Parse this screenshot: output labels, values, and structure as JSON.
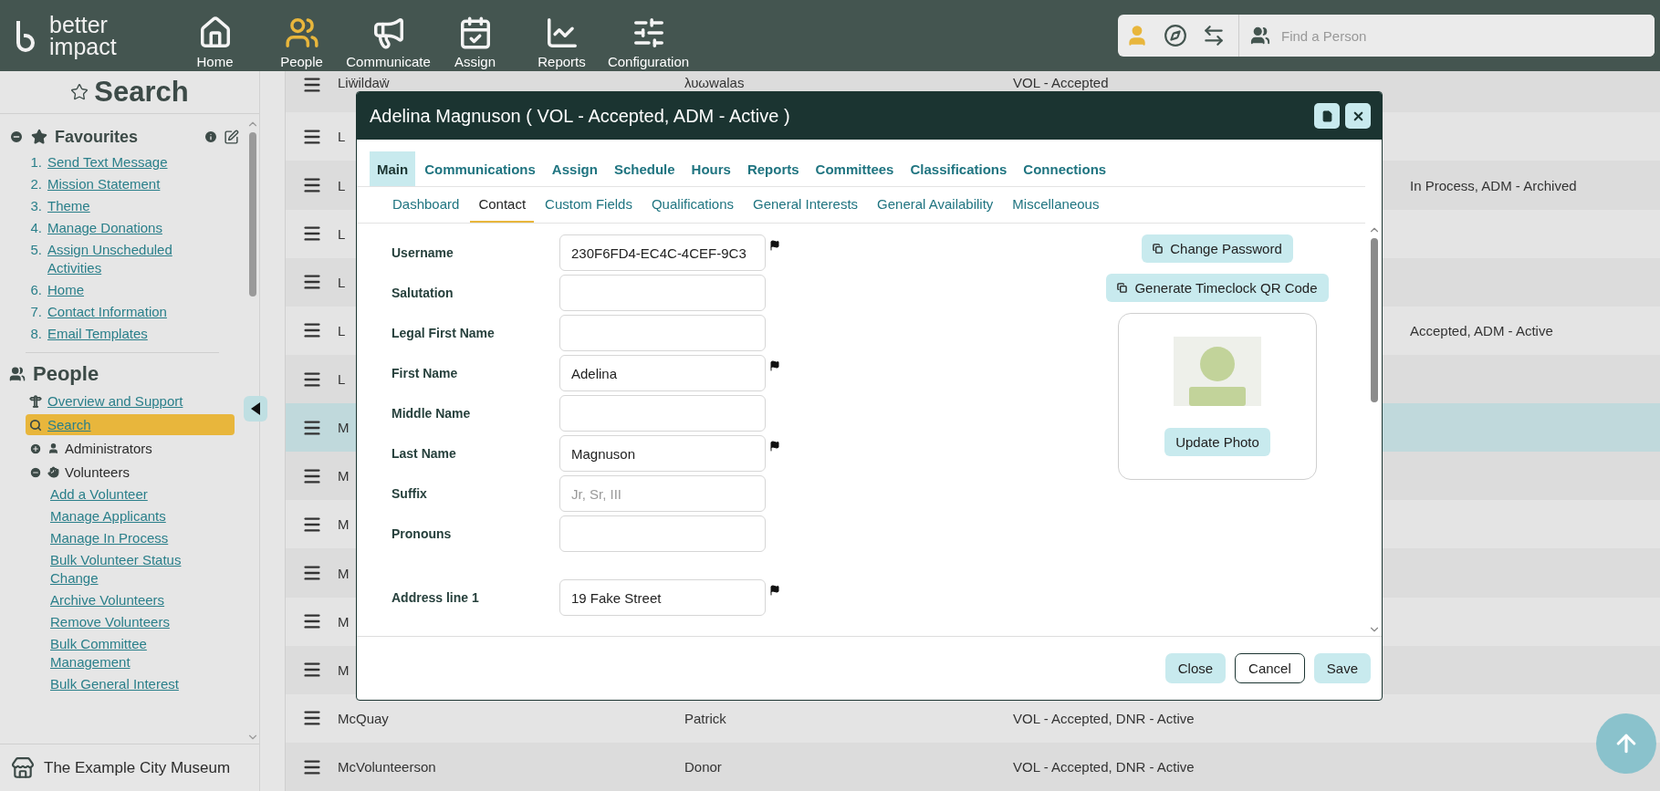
{
  "header": {
    "logo": [
      "better",
      "impact"
    ],
    "nav": [
      {
        "label": "Home",
        "selected": false
      },
      {
        "label": "People",
        "selected": true
      },
      {
        "label": "Communicate",
        "selected": false
      },
      {
        "label": "Assign",
        "selected": false
      },
      {
        "label": "Reports",
        "selected": false
      },
      {
        "label": "Configuration",
        "selected": false
      }
    ],
    "search": {
      "placeholder": "Find a Person"
    }
  },
  "sidebar": {
    "title": "Search",
    "favourites": {
      "title": "Favourites",
      "expanded": true,
      "items": [
        {
          "number": "1.",
          "label": "Send Text Message"
        },
        {
          "number": "2.",
          "label": "Mission Statement"
        },
        {
          "number": "3.",
          "label": "Theme"
        },
        {
          "number": "4.",
          "label": "Manage Donations"
        },
        {
          "number": "5.",
          "label": "Assign Unscheduled Activities"
        },
        {
          "number": "6.",
          "label": "Home"
        },
        {
          "number": "7.",
          "label": "Contact Information"
        },
        {
          "number": "8.",
          "label": "Email Templates"
        }
      ]
    },
    "people": {
      "title": "People",
      "items": [
        {
          "kind": "link",
          "label": "Overview and Support",
          "selected": false
        },
        {
          "kind": "link",
          "label": "Search",
          "selected": true
        },
        {
          "kind": "group",
          "label": "Administrators",
          "expanded": false
        },
        {
          "kind": "group",
          "label": "Volunteers",
          "expanded": true,
          "children": [
            "Add a Volunteer",
            "Manage Applicants",
            "Manage In Process",
            "Bulk Volunteer Status Change",
            "Archive Volunteers",
            "Remove Volunteers",
            "Bulk Committee Management",
            "Bulk General Interest"
          ]
        }
      ]
    },
    "organization": "The Example City Museum"
  },
  "table": {
    "rows": [
      {
        "name": "Liẅildaẅ",
        "first_name": "λυωwalas",
        "status": "VOL - Accepted",
        "selected": false
      },
      {
        "name": "L",
        "selected": false
      },
      {
        "name": "L",
        "status_tail": "In Process, ADM - Archived",
        "selected": false
      },
      {
        "name": "L",
        "selected": false
      },
      {
        "name": "L",
        "selected": false
      },
      {
        "name": "L",
        "status_tail": "Accepted, ADM - Active",
        "selected": false
      },
      {
        "name": "L",
        "selected": false
      },
      {
        "name": "M",
        "selected": true
      },
      {
        "name": "M",
        "selected": false
      },
      {
        "name": "M",
        "selected": false
      },
      {
        "name": "M",
        "selected": false
      },
      {
        "name": "M",
        "selected": false
      },
      {
        "name": "M",
        "selected": false
      },
      {
        "name": "McQuay",
        "first_name": "Patrick",
        "status": "VOL - Accepted, DNR - Active",
        "selected": false
      },
      {
        "name": "McVolunteerson",
        "first_name": "Donor",
        "status": "VOL - Accepted, DNR - Active",
        "selected": false
      }
    ]
  },
  "dialog": {
    "title": "Adelina Magnuson ( VOL - Accepted, ADM - Active )",
    "tabs": [
      {
        "label": "Main",
        "selected": true
      },
      {
        "label": "Communications",
        "selected": false
      },
      {
        "label": "Assign",
        "selected": false
      },
      {
        "label": "Schedule",
        "selected": false
      },
      {
        "label": "Hours",
        "selected": false
      },
      {
        "label": "Reports",
        "selected": false
      },
      {
        "label": "Committees",
        "selected": false
      },
      {
        "label": "Classifications",
        "selected": false
      },
      {
        "label": "Connections",
        "selected": false
      }
    ],
    "subtabs": [
      {
        "label": "Dashboard",
        "selected": false
      },
      {
        "label": "Contact",
        "selected": true
      },
      {
        "label": "Custom Fields",
        "selected": false
      },
      {
        "label": "Qualifications",
        "selected": false
      },
      {
        "label": "General Interests",
        "selected": false
      },
      {
        "label": "General Availability",
        "selected": false
      },
      {
        "label": "Miscellaneous",
        "selected": false
      }
    ],
    "fields": [
      {
        "label": "Username",
        "value": "230F6FD4-EC4C-4CEF-9C3",
        "flagged": true
      },
      {
        "label": "Salutation",
        "flagged": false
      },
      {
        "label": "Legal First Name",
        "flagged": false
      },
      {
        "label": "First Name",
        "value": "Adelina",
        "flagged": true
      },
      {
        "label": "Middle Name",
        "flagged": false
      },
      {
        "label": "Last Name",
        "value": "Magnuson",
        "flagged": true
      },
      {
        "label": "Suffix",
        "placeholder": "Jr, Sr, III",
        "flagged": false
      },
      {
        "label": "Pronouns",
        "flagged": false
      }
    ],
    "address_fields": [
      {
        "label": "Address line 1",
        "value": "19 Fake Street",
        "flagged": true
      }
    ],
    "actions": [
      "Change Password",
      "Generate Timeclock QR Code"
    ],
    "photo_button": "Update Photo",
    "footer_buttons": [
      {
        "label": "Close",
        "kind": "filled"
      },
      {
        "label": "Cancel",
        "kind": "outlined"
      },
      {
        "label": "Save",
        "kind": "filled"
      }
    ]
  }
}
